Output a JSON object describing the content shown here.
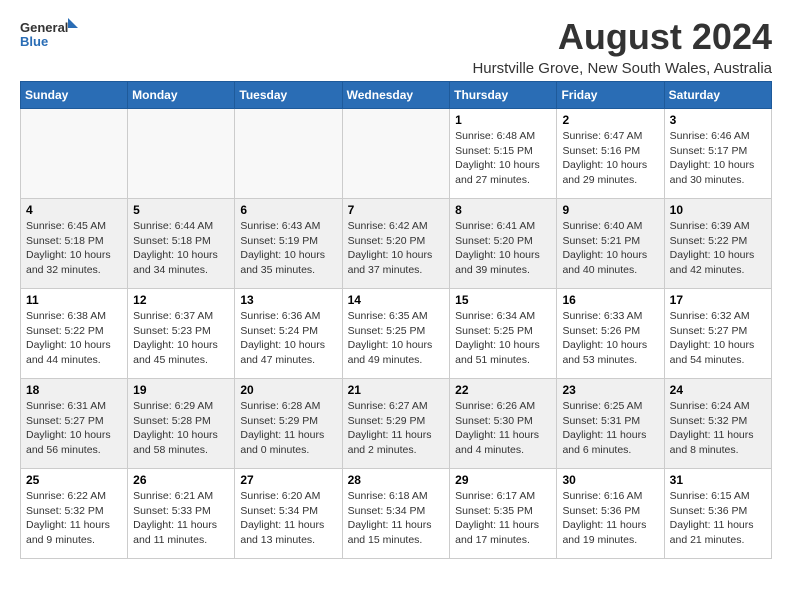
{
  "logo": {
    "line1": "General",
    "line2": "Blue"
  },
  "title": "August 2024",
  "subtitle": "Hurstville Grove, New South Wales, Australia",
  "days_header": [
    "Sunday",
    "Monday",
    "Tuesday",
    "Wednesday",
    "Thursday",
    "Friday",
    "Saturday"
  ],
  "weeks": [
    [
      {
        "num": "",
        "info": ""
      },
      {
        "num": "",
        "info": ""
      },
      {
        "num": "",
        "info": ""
      },
      {
        "num": "",
        "info": ""
      },
      {
        "num": "1",
        "info": "Sunrise: 6:48 AM\nSunset: 5:15 PM\nDaylight: 10 hours\nand 27 minutes."
      },
      {
        "num": "2",
        "info": "Sunrise: 6:47 AM\nSunset: 5:16 PM\nDaylight: 10 hours\nand 29 minutes."
      },
      {
        "num": "3",
        "info": "Sunrise: 6:46 AM\nSunset: 5:17 PM\nDaylight: 10 hours\nand 30 minutes."
      }
    ],
    [
      {
        "num": "4",
        "info": "Sunrise: 6:45 AM\nSunset: 5:18 PM\nDaylight: 10 hours\nand 32 minutes."
      },
      {
        "num": "5",
        "info": "Sunrise: 6:44 AM\nSunset: 5:18 PM\nDaylight: 10 hours\nand 34 minutes."
      },
      {
        "num": "6",
        "info": "Sunrise: 6:43 AM\nSunset: 5:19 PM\nDaylight: 10 hours\nand 35 minutes."
      },
      {
        "num": "7",
        "info": "Sunrise: 6:42 AM\nSunset: 5:20 PM\nDaylight: 10 hours\nand 37 minutes."
      },
      {
        "num": "8",
        "info": "Sunrise: 6:41 AM\nSunset: 5:20 PM\nDaylight: 10 hours\nand 39 minutes."
      },
      {
        "num": "9",
        "info": "Sunrise: 6:40 AM\nSunset: 5:21 PM\nDaylight: 10 hours\nand 40 minutes."
      },
      {
        "num": "10",
        "info": "Sunrise: 6:39 AM\nSunset: 5:22 PM\nDaylight: 10 hours\nand 42 minutes."
      }
    ],
    [
      {
        "num": "11",
        "info": "Sunrise: 6:38 AM\nSunset: 5:22 PM\nDaylight: 10 hours\nand 44 minutes."
      },
      {
        "num": "12",
        "info": "Sunrise: 6:37 AM\nSunset: 5:23 PM\nDaylight: 10 hours\nand 45 minutes."
      },
      {
        "num": "13",
        "info": "Sunrise: 6:36 AM\nSunset: 5:24 PM\nDaylight: 10 hours\nand 47 minutes."
      },
      {
        "num": "14",
        "info": "Sunrise: 6:35 AM\nSunset: 5:25 PM\nDaylight: 10 hours\nand 49 minutes."
      },
      {
        "num": "15",
        "info": "Sunrise: 6:34 AM\nSunset: 5:25 PM\nDaylight: 10 hours\nand 51 minutes."
      },
      {
        "num": "16",
        "info": "Sunrise: 6:33 AM\nSunset: 5:26 PM\nDaylight: 10 hours\nand 53 minutes."
      },
      {
        "num": "17",
        "info": "Sunrise: 6:32 AM\nSunset: 5:27 PM\nDaylight: 10 hours\nand 54 minutes."
      }
    ],
    [
      {
        "num": "18",
        "info": "Sunrise: 6:31 AM\nSunset: 5:27 PM\nDaylight: 10 hours\nand 56 minutes."
      },
      {
        "num": "19",
        "info": "Sunrise: 6:29 AM\nSunset: 5:28 PM\nDaylight: 10 hours\nand 58 minutes."
      },
      {
        "num": "20",
        "info": "Sunrise: 6:28 AM\nSunset: 5:29 PM\nDaylight: 11 hours\nand 0 minutes."
      },
      {
        "num": "21",
        "info": "Sunrise: 6:27 AM\nSunset: 5:29 PM\nDaylight: 11 hours\nand 2 minutes."
      },
      {
        "num": "22",
        "info": "Sunrise: 6:26 AM\nSunset: 5:30 PM\nDaylight: 11 hours\nand 4 minutes."
      },
      {
        "num": "23",
        "info": "Sunrise: 6:25 AM\nSunset: 5:31 PM\nDaylight: 11 hours\nand 6 minutes."
      },
      {
        "num": "24",
        "info": "Sunrise: 6:24 AM\nSunset: 5:32 PM\nDaylight: 11 hours\nand 8 minutes."
      }
    ],
    [
      {
        "num": "25",
        "info": "Sunrise: 6:22 AM\nSunset: 5:32 PM\nDaylight: 11 hours\nand 9 minutes."
      },
      {
        "num": "26",
        "info": "Sunrise: 6:21 AM\nSunset: 5:33 PM\nDaylight: 11 hours\nand 11 minutes."
      },
      {
        "num": "27",
        "info": "Sunrise: 6:20 AM\nSunset: 5:34 PM\nDaylight: 11 hours\nand 13 minutes."
      },
      {
        "num": "28",
        "info": "Sunrise: 6:18 AM\nSunset: 5:34 PM\nDaylight: 11 hours\nand 15 minutes."
      },
      {
        "num": "29",
        "info": "Sunrise: 6:17 AM\nSunset: 5:35 PM\nDaylight: 11 hours\nand 17 minutes."
      },
      {
        "num": "30",
        "info": "Sunrise: 6:16 AM\nSunset: 5:36 PM\nDaylight: 11 hours\nand 19 minutes."
      },
      {
        "num": "31",
        "info": "Sunrise: 6:15 AM\nSunset: 5:36 PM\nDaylight: 11 hours\nand 21 minutes."
      }
    ]
  ]
}
